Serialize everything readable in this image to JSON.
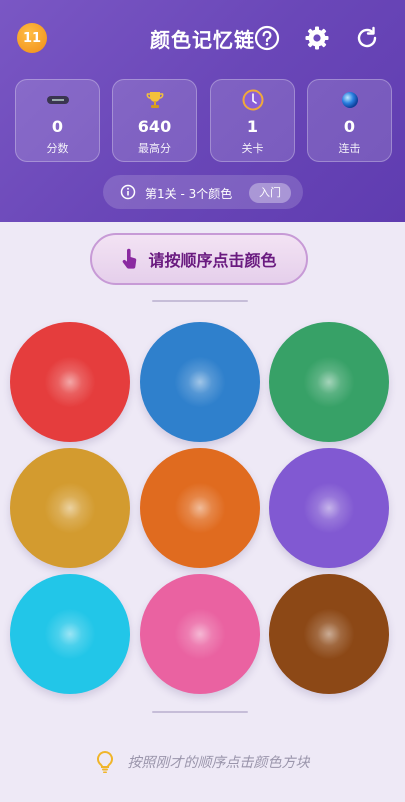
{
  "header": {
    "logo_text": "11",
    "title": "颜色记忆链",
    "icons": [
      "help-circle-icon",
      "gear-icon",
      "refresh-icon"
    ]
  },
  "stats": [
    {
      "icon": "gamepad-icon",
      "value": "0",
      "label": "分数"
    },
    {
      "icon": "trophy-icon",
      "value": "640",
      "label": "最高分"
    },
    {
      "icon": "level-badge-icon",
      "value": "1",
      "label": "关卡"
    },
    {
      "icon": "orb-icon",
      "value": "0",
      "label": "连击"
    }
  ],
  "level": {
    "text": "第1关 - 3个颜色",
    "difficulty": "入门"
  },
  "prompt": {
    "text": "请按顺序点击颜色",
    "icon": "hand-pointer-icon"
  },
  "colors": [
    {
      "name": "red",
      "hex": "#e53d3d"
    },
    {
      "name": "blue",
      "hex": "#2f80cc"
    },
    {
      "name": "green",
      "hex": "#37a167"
    },
    {
      "name": "gold",
      "hex": "#d39b2f"
    },
    {
      "name": "orange",
      "hex": "#e06b1f"
    },
    {
      "name": "purple",
      "hex": "#8159d2"
    },
    {
      "name": "cyan",
      "hex": "#22c6e8"
    },
    {
      "name": "pink",
      "hex": "#ea62a1"
    },
    {
      "name": "brown",
      "hex": "#8c4816"
    }
  ],
  "hint": {
    "text": "按照刚才的顺序点击颜色方块",
    "icon": "lightbulb-icon"
  },
  "theme": {
    "header": "#6c4bbb",
    "accent": "#c79ad6"
  }
}
